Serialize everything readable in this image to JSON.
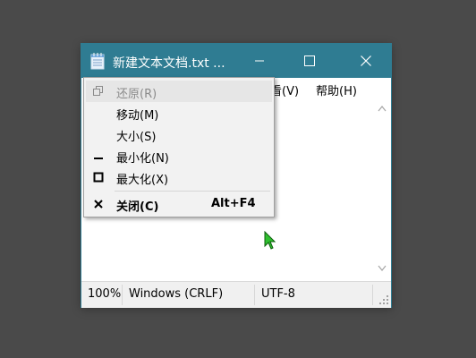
{
  "window": {
    "title": "新建文本文档.txt ...",
    "colors": {
      "titlebar": "#2f7c92",
      "desktop": "#4a4a4a"
    },
    "icons": [
      "notepad-icon",
      "minimize-icon",
      "maximize-icon",
      "close-icon"
    ]
  },
  "menubar": {
    "view": "看(V)",
    "help": "帮助(H)"
  },
  "statusbar": {
    "zoom": "100%",
    "line_ending": "Windows (CRLF)",
    "encoding": "UTF-8"
  },
  "system_menu": {
    "items": [
      {
        "label": "还原(R)",
        "icon": "restore-icon",
        "disabled": true
      },
      {
        "label": "移动(M)"
      },
      {
        "label": "大小(S)"
      },
      {
        "label": "最小化(N)",
        "icon": "minimize-icon"
      },
      {
        "label": "最大化(X)",
        "icon": "maximize-icon"
      },
      {
        "label": "关闭(C)",
        "icon": "close-icon",
        "accelerator": "Alt+F4"
      }
    ]
  }
}
